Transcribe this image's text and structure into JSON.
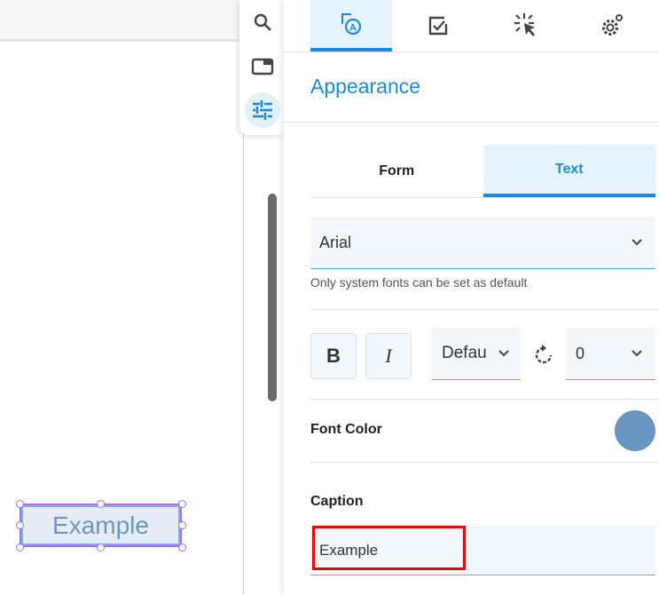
{
  "toolbar": {
    "items": [
      "search-icon",
      "panel-icon",
      "sliders-icon"
    ],
    "active": "sliders-icon"
  },
  "panel": {
    "tabs": [
      "appearance-icon",
      "checkbox-icon",
      "click-icon",
      "settings-icon"
    ],
    "title": "Appearance",
    "subtabs": {
      "form": "Form",
      "text": "Text",
      "active": "Text"
    },
    "font": {
      "value": "Arial",
      "hint": "Only system fonts can be set as default"
    },
    "style": {
      "bold": "B",
      "italic": "I",
      "size": "Defau",
      "rotation": "0"
    },
    "font_color": {
      "label": "Font Color",
      "value": "#6b96c4"
    },
    "caption": {
      "label": "Caption",
      "value": "Example"
    }
  },
  "canvas": {
    "element_text": "Example"
  },
  "colors": {
    "accent": "#1a8ae0",
    "highlight": "#e00000"
  }
}
